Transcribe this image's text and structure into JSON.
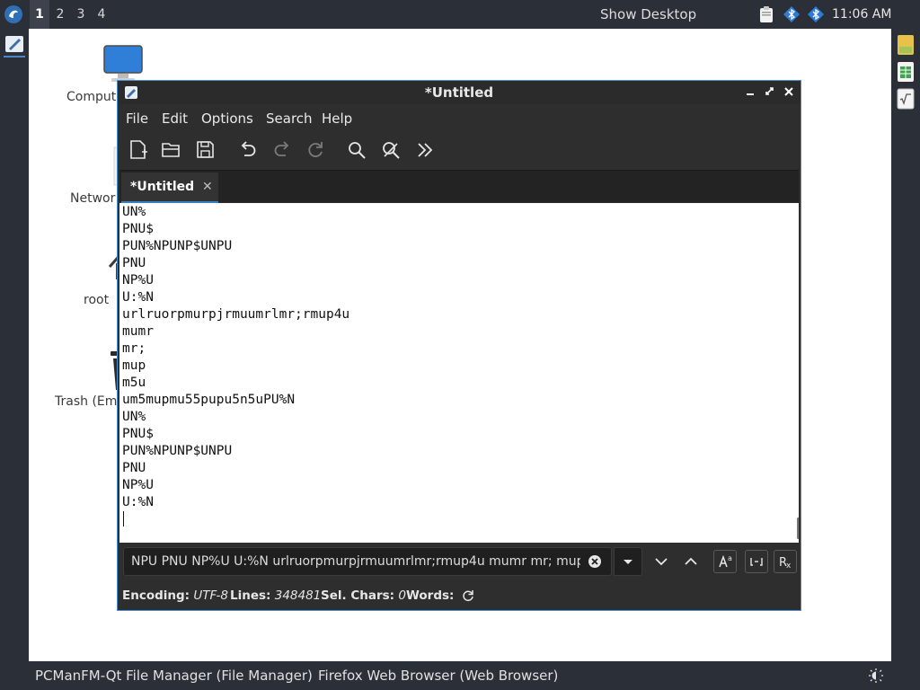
{
  "top_panel": {
    "workspaces": [
      "1",
      "2",
      "3",
      "4"
    ],
    "show_desktop": "Show Desktop",
    "clock": "11:06 AM"
  },
  "desktop_icons": [
    {
      "label": "Comput",
      "icon": "computer-icon"
    },
    {
      "label": "Networ",
      "icon": "network-file-icon"
    },
    {
      "label": "root",
      "icon": "home-folder-icon"
    },
    {
      "label": "Trash (Em",
      "icon": "trash-icon"
    }
  ],
  "window": {
    "title": "*Untitled",
    "menus": [
      "File",
      "Edit",
      "Options",
      "Search",
      "Help"
    ],
    "tab_label": "*Untitled",
    "tab_close": "✕",
    "editor_lines": [
      "UN%",
      "PNU$",
      "PUN%NPUNP$UNPU",
      "PNU",
      "NP%U",
      "U:%N",
      "urlruorpmurpjrmuumrlmr;rmup4u",
      "mumr",
      "mr;",
      "mup",
      "m5u",
      "um5mupmu55pupu5n5uPU%N",
      "UN%",
      "PNU$",
      "PUN%NPUNP$UNPU",
      "PNU",
      "NP%U",
      "U:%N"
    ],
    "find_text": "NPU PNU NP%U U:%N urlruorpmurpjrmuumrlmr;rmup4u mumr mr; mup",
    "status": {
      "encoding_label": "Encoding:",
      "encoding_value": "UTF-8",
      "lines_label": "Lines:",
      "lines_value": "348481",
      "sel_label": "Sel. Chars:",
      "sel_value": "0",
      "words_label": "Words:"
    }
  },
  "taskbar": {
    "tasks": [
      "PCManFM-Qt File Manager (File Manager)",
      "Firefox Web Browser (Web Browser)"
    ]
  },
  "colors": {
    "panel": "#2b2f38",
    "window_border": "#4a8ed0",
    "tab_accent": "#3d7fc4"
  }
}
